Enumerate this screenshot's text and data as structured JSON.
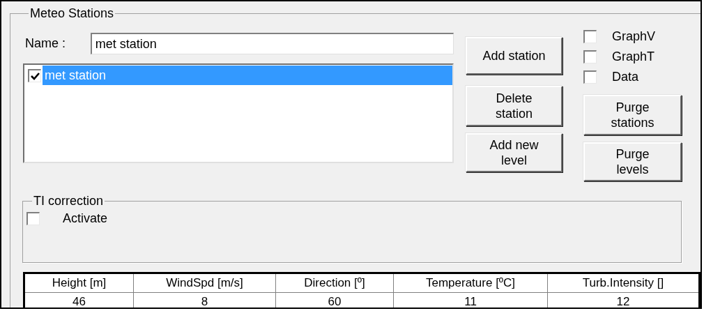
{
  "group": {
    "title": "Meteo Stations"
  },
  "name_field": {
    "label": "Name :",
    "value": "met station"
  },
  "stations": [
    {
      "label": "met station",
      "checked": true,
      "selected": true
    }
  ],
  "station_buttons": [
    "Add station",
    "Delete\nstation",
    "Add new\nlevel"
  ],
  "options": [
    {
      "label": "GraphV",
      "checked": false
    },
    {
      "label": "GraphT",
      "checked": false
    },
    {
      "label": "Data",
      "checked": false
    }
  ],
  "purge_buttons": [
    "Purge\nstations",
    "Purge\nlevels"
  ],
  "ti_correction": {
    "title": "TI correction",
    "activate": {
      "label": "Activate",
      "checked": false
    }
  },
  "table": {
    "columns": [
      "Height [m]",
      "WindSpd [m/s]",
      "Direction [º]",
      "Temperature [ºC]",
      "Turb.Intensity []"
    ],
    "rows": [
      [
        "46",
        "8",
        "60",
        "11",
        "12"
      ]
    ]
  }
}
